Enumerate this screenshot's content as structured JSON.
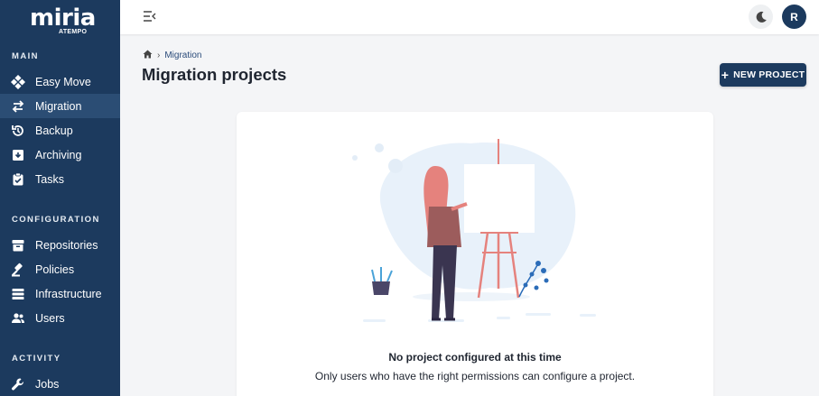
{
  "app": {
    "logo_text": "miria",
    "logo_sub": "ATEMPO"
  },
  "sidebar": {
    "sections": [
      {
        "title": "MAIN"
      },
      {
        "title": "CONFIGURATION"
      },
      {
        "title": "ACTIVITY"
      }
    ],
    "items": [
      {
        "label": "Easy Move",
        "icon": "easy-move-icon"
      },
      {
        "label": "Migration",
        "icon": "migration-icon",
        "active": true
      },
      {
        "label": "Backup",
        "icon": "backup-icon"
      },
      {
        "label": "Archiving",
        "icon": "archiving-icon"
      },
      {
        "label": "Tasks",
        "icon": "tasks-icon"
      },
      {
        "label": "Repositories",
        "icon": "repositories-icon"
      },
      {
        "label": "Policies",
        "icon": "policies-icon"
      },
      {
        "label": "Infrastructure",
        "icon": "infrastructure-icon"
      },
      {
        "label": "Users",
        "icon": "users-icon"
      },
      {
        "label": "Jobs",
        "icon": "jobs-icon"
      }
    ]
  },
  "topbar": {
    "avatar_initial": "R"
  },
  "breadcrumb": {
    "current": "Migration"
  },
  "page": {
    "title": "Migration projects",
    "new_button_label": "NEW PROJECT"
  },
  "empty_state": {
    "title": "No project configured at this time",
    "description": "Only users who have the right permissions can configure a project."
  },
  "colors": {
    "sidebar_bg": "#1c3a5e",
    "sidebar_active": "#2b4d74",
    "accent": "#1c3a5e",
    "illustration_hair": "#e5827d",
    "illustration_blob": "#e8f1fa"
  }
}
